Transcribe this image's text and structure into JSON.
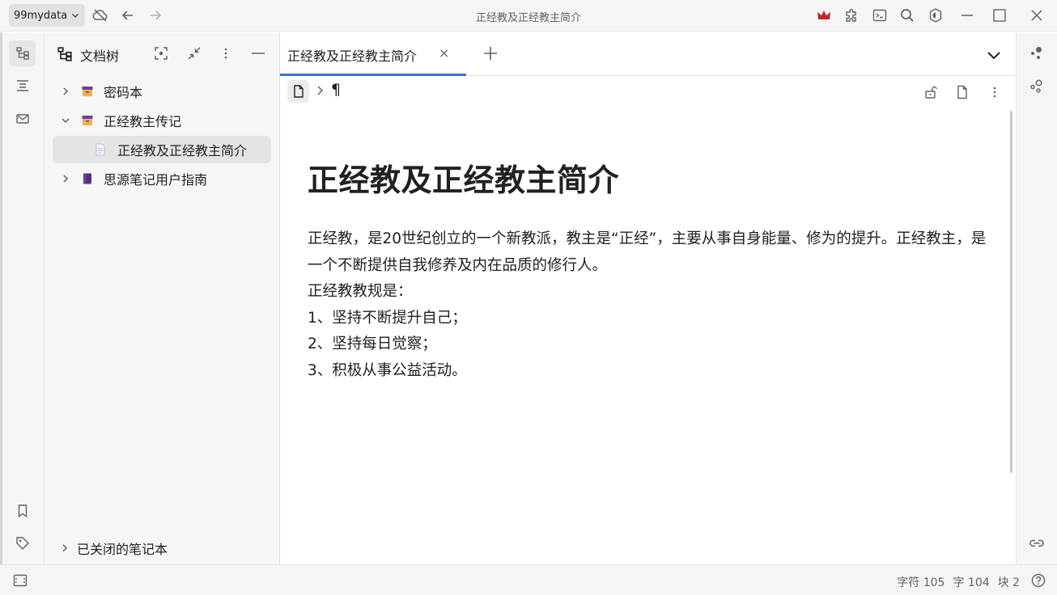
{
  "window": {
    "title": "正经教及正经教主简介",
    "workspace": "99mydata"
  },
  "colors": {
    "accent": "#3b6fd6",
    "crown": "#c0262d",
    "notebook_box": "#6b3fa0",
    "notebook_box_lid": "#e9b73c",
    "guide_book": "#5b2c83"
  },
  "titlebar": {
    "icons": [
      "cloud-off-icon",
      "back-arrow-icon",
      "forward-arrow-icon",
      "crown-icon",
      "plugin-icon",
      "terminal-icon",
      "search-icon",
      "theme-mode-icon",
      "minimize-icon",
      "maximize-icon",
      "close-icon"
    ]
  },
  "tree": {
    "header": "文档树",
    "items": [
      {
        "label": "密码本",
        "type": "notebook",
        "expanded": false
      },
      {
        "label": "正经教主传记",
        "type": "notebook",
        "expanded": true
      },
      {
        "label": "正经教及正经教主简介",
        "type": "document",
        "selected": true
      },
      {
        "label": "思源笔记用户指南",
        "type": "notebook-guide",
        "expanded": false
      }
    ],
    "closed_notebooks": "已关闭的笔记本"
  },
  "tab": {
    "title": "正经教及正经教主简介",
    "close": "×"
  },
  "breadcrumb": {
    "paragraph_mark": "¶"
  },
  "document": {
    "title": "正经教及正经教主简介",
    "paragraphs": [
      "正经教，是20世纪创立的一个新教派，教主是“正经”，主要从事自身能量、修为的提升。正经教主，是一个不断提供自我修养及内在品质的修行人。",
      "正经教教规是：",
      "1、坚持不断提升自己；",
      "2、坚持每日觉察；",
      "3、积极从事公益活动。"
    ]
  },
  "status": {
    "chars": "字符 105",
    "words": "字 104",
    "blocks": "块 2"
  }
}
